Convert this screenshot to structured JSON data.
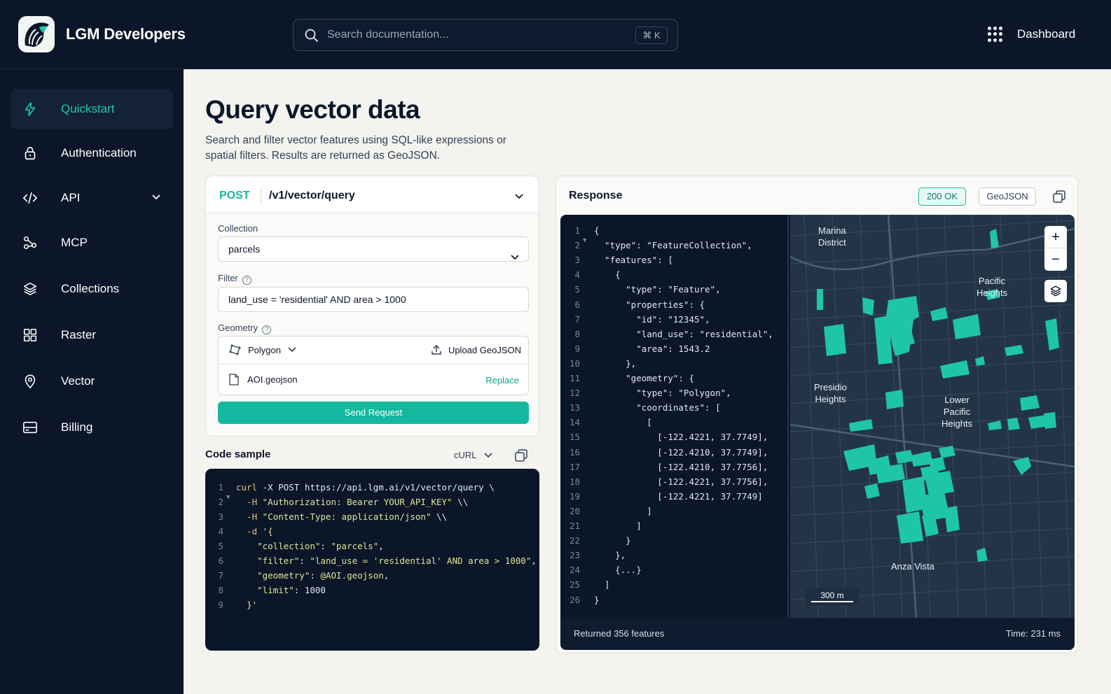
{
  "header": {
    "brand": "LGM Developers",
    "search_placeholder": "Search documentation...",
    "search_shortcut": "⌘ K",
    "dashboard_label": "Dashboard"
  },
  "sidebar": {
    "items": [
      {
        "label": "Quickstart",
        "icon": "lightning-icon",
        "active": true
      },
      {
        "label": "Authentication",
        "icon": "lock-icon"
      },
      {
        "label": "API",
        "icon": "code-icon",
        "expandable": true
      },
      {
        "label": "MCP",
        "icon": "nodes-icon"
      },
      {
        "label": "Collections",
        "icon": "layers-icon"
      },
      {
        "label": "Raster",
        "icon": "grid-icon"
      },
      {
        "label": "Vector",
        "icon": "map-pin-icon"
      },
      {
        "label": "Billing",
        "icon": "card-icon"
      }
    ]
  },
  "page": {
    "title": "Query vector data",
    "description": "Search and filter vector features using SQL-like expressions or spatial filters. Results are returned as GeoJSON."
  },
  "request": {
    "method": "POST",
    "endpoint": "/v1/vector/query",
    "collection_label": "Collection",
    "collection_value": "parcels",
    "filter_label": "Filter",
    "filter_value": "land_use = 'residential' AND area > 1000",
    "geometry_label": "Geometry",
    "geometry_type": "Polygon",
    "upload_label": "Upload GeoJSON",
    "file_name": "AOI.geojson",
    "replace_label": "Replace",
    "send_label": "Send Request"
  },
  "code_sample": {
    "title": "Code sample",
    "language": "cURL",
    "lines": [
      {
        "n": "1",
        "fold": true,
        "parts": [
          [
            "c",
            "curl"
          ],
          [
            "p",
            " -X POST https://api.lgm.ai/v1/vector/query \\"
          ]
        ]
      },
      {
        "n": "2",
        "parts": [
          [
            "p",
            "  "
          ],
          [
            "c",
            "-H"
          ],
          [
            "p",
            " "
          ],
          [
            "s",
            "\"Authorization: Bearer YOUR_API_KEY\""
          ],
          [
            "p",
            " \\\\"
          ]
        ]
      },
      {
        "n": "3",
        "parts": [
          [
            "p",
            "  "
          ],
          [
            "c",
            "-H"
          ],
          [
            "p",
            " "
          ],
          [
            "s",
            "\"Content-Type: application/json\""
          ],
          [
            "p",
            " \\\\"
          ]
        ]
      },
      {
        "n": "4",
        "parts": [
          [
            "p",
            "  "
          ],
          [
            "c",
            "-d"
          ],
          [
            "p",
            " "
          ],
          [
            "s",
            "'{"
          ]
        ]
      },
      {
        "n": "5",
        "parts": [
          [
            "p",
            "    "
          ],
          [
            "s",
            "\"collection\""
          ],
          [
            "p",
            ": "
          ],
          [
            "s",
            "\"parcels\""
          ],
          [
            "p",
            ","
          ]
        ]
      },
      {
        "n": "6",
        "parts": [
          [
            "p",
            "    "
          ],
          [
            "s",
            "\"filter\""
          ],
          [
            "p",
            ": "
          ],
          [
            "s",
            "\"land_use = 'residential' AND area > 1000\""
          ],
          [
            "p",
            ","
          ]
        ]
      },
      {
        "n": "7",
        "parts": [
          [
            "p",
            "    "
          ],
          [
            "s",
            "\"geometry\""
          ],
          [
            "p",
            ": "
          ],
          [
            "s",
            "@AOI.geojson"
          ],
          [
            "p",
            ","
          ]
        ]
      },
      {
        "n": "8",
        "parts": [
          [
            "p",
            "    "
          ],
          [
            "s",
            "\"limit\""
          ],
          [
            "p",
            ": 1000"
          ]
        ]
      },
      {
        "n": "9",
        "parts": [
          [
            "p",
            "  "
          ],
          [
            "s",
            "}'"
          ]
        ]
      }
    ]
  },
  "response": {
    "title": "Response",
    "status": "200 OK",
    "format": "GeoJSON",
    "lines": [
      {
        "n": "1",
        "fold": true,
        "t": "{"
      },
      {
        "n": "2",
        "t": "  \"type\": \"FeatureCollection\","
      },
      {
        "n": "3",
        "t": "  \"features\": ["
      },
      {
        "n": "4",
        "t": "    {"
      },
      {
        "n": "5",
        "t": "      \"type\": \"Feature\","
      },
      {
        "n": "6",
        "t": "      \"properties\": {"
      },
      {
        "n": "7",
        "t": "        \"id\": \"12345\","
      },
      {
        "n": "8",
        "t": "        \"land_use\": \"residential\","
      },
      {
        "n": "9",
        "t": "        \"area\": 1543.2"
      },
      {
        "n": "10",
        "t": "      },"
      },
      {
        "n": "11",
        "t": "      \"geometry\": {"
      },
      {
        "n": "12",
        "t": "        \"type\": \"Polygon\","
      },
      {
        "n": "13",
        "t": "        \"coordinates\": ["
      },
      {
        "n": "14",
        "t": "          ["
      },
      {
        "n": "15",
        "t": "            [-122.4221, 37.7749],"
      },
      {
        "n": "16",
        "t": "            [-122.4210, 37.7749],"
      },
      {
        "n": "17",
        "t": "            [-122.4210, 37.7756],"
      },
      {
        "n": "18",
        "t": "            [-122.4221, 37.7756],"
      },
      {
        "n": "19",
        "t": "            [-122.4221, 37.7749]"
      },
      {
        "n": "20",
        "t": "          ]"
      },
      {
        "n": "21",
        "t": "        ]"
      },
      {
        "n": "22",
        "t": "      }"
      },
      {
        "n": "23",
        "t": "    },"
      },
      {
        "n": "24",
        "t": "    {...}"
      },
      {
        "n": "25",
        "t": "  ]"
      },
      {
        "n": "26",
        "t": "}"
      }
    ],
    "map": {
      "labels": {
        "marina": "Marina\nDistrict",
        "pacific": "Pacific\nHeights",
        "presidio": "Presidio\nHeights",
        "lower_pacific": "Lower\nPacific\nHeights",
        "anza": "Anza Vista"
      },
      "zoom_in": "+",
      "zoom_out": "−",
      "scale": "300 m"
    },
    "footer_left": "Returned 356 features",
    "footer_right": "Time: 231 ms"
  },
  "colors": {
    "navy": "#0b1628",
    "accent": "#14b89e",
    "parcel": "#1ec6a6",
    "map_bg": "#243447"
  }
}
